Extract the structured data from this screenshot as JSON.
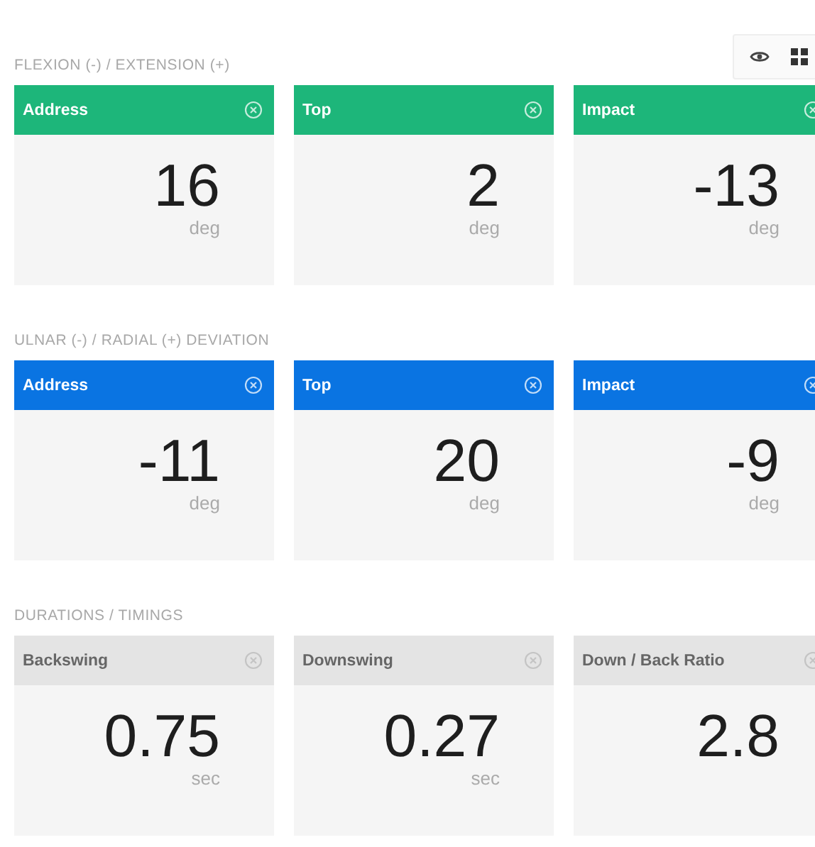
{
  "sections": [
    {
      "title": "FLEXION (-) / EXTENSION (+)",
      "color": "#1db67a",
      "cards": [
        {
          "label": "Address",
          "value": "16",
          "unit": "deg"
        },
        {
          "label": "Top",
          "value": "2",
          "unit": "deg"
        },
        {
          "label": "Impact",
          "value": "-13",
          "unit": "deg"
        }
      ]
    },
    {
      "title": "ULNAR (-) / RADIAL (+) DEVIATION",
      "color": "#0a74e2",
      "cards": [
        {
          "label": "Address",
          "value": "-11",
          "unit": "deg"
        },
        {
          "label": "Top",
          "value": "20",
          "unit": "deg"
        },
        {
          "label": "Impact",
          "value": "-9",
          "unit": "deg"
        }
      ]
    },
    {
      "title": "DURATIONS / TIMINGS",
      "color": "#e4e4e4",
      "cards": [
        {
          "label": "Backswing",
          "value": "0.75",
          "unit": "sec"
        },
        {
          "label": "Downswing",
          "value": "0.27",
          "unit": "sec"
        },
        {
          "label": "Down / Back Ratio",
          "value": "2.8"
        }
      ]
    }
  ]
}
